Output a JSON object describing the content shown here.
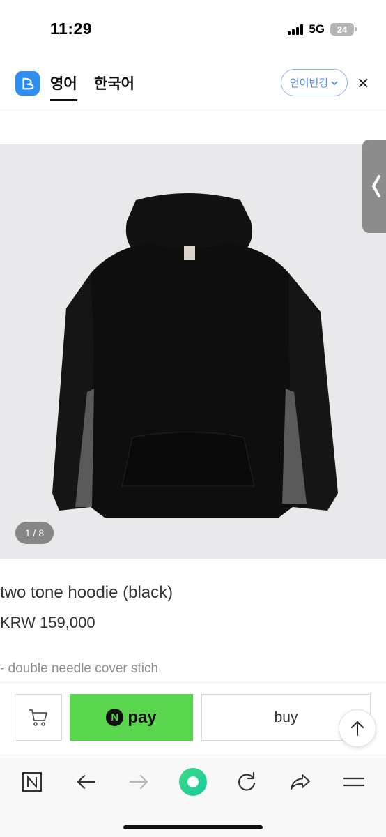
{
  "status_bar": {
    "time": "11:29",
    "network": "5G",
    "battery": "24"
  },
  "translate_header": {
    "tabs": [
      {
        "label": "영어",
        "active": true
      },
      {
        "label": "한국어",
        "active": false
      }
    ],
    "change_language_label": "언어변경",
    "close_icon": "close-icon",
    "accent_color": "#4f86e8"
  },
  "product": {
    "image_counter": "1 / 8",
    "title": "two tone hoodie (black)",
    "price": "KRW 159,000",
    "description": "- double needle cover stich"
  },
  "action_bar": {
    "cart_icon": "cart-icon",
    "npay_badge": "N",
    "npay_label": "pay",
    "npay_color": "#5ad64e",
    "buy_label": "buy",
    "scroll_top_icon": "arrow-up-icon"
  },
  "browser_bar": {
    "items": [
      "naver-n-icon",
      "back-arrow-icon",
      "forward-arrow-icon",
      "home-green-circle-icon",
      "refresh-icon",
      "share-icon",
      "menu-icon"
    ]
  }
}
